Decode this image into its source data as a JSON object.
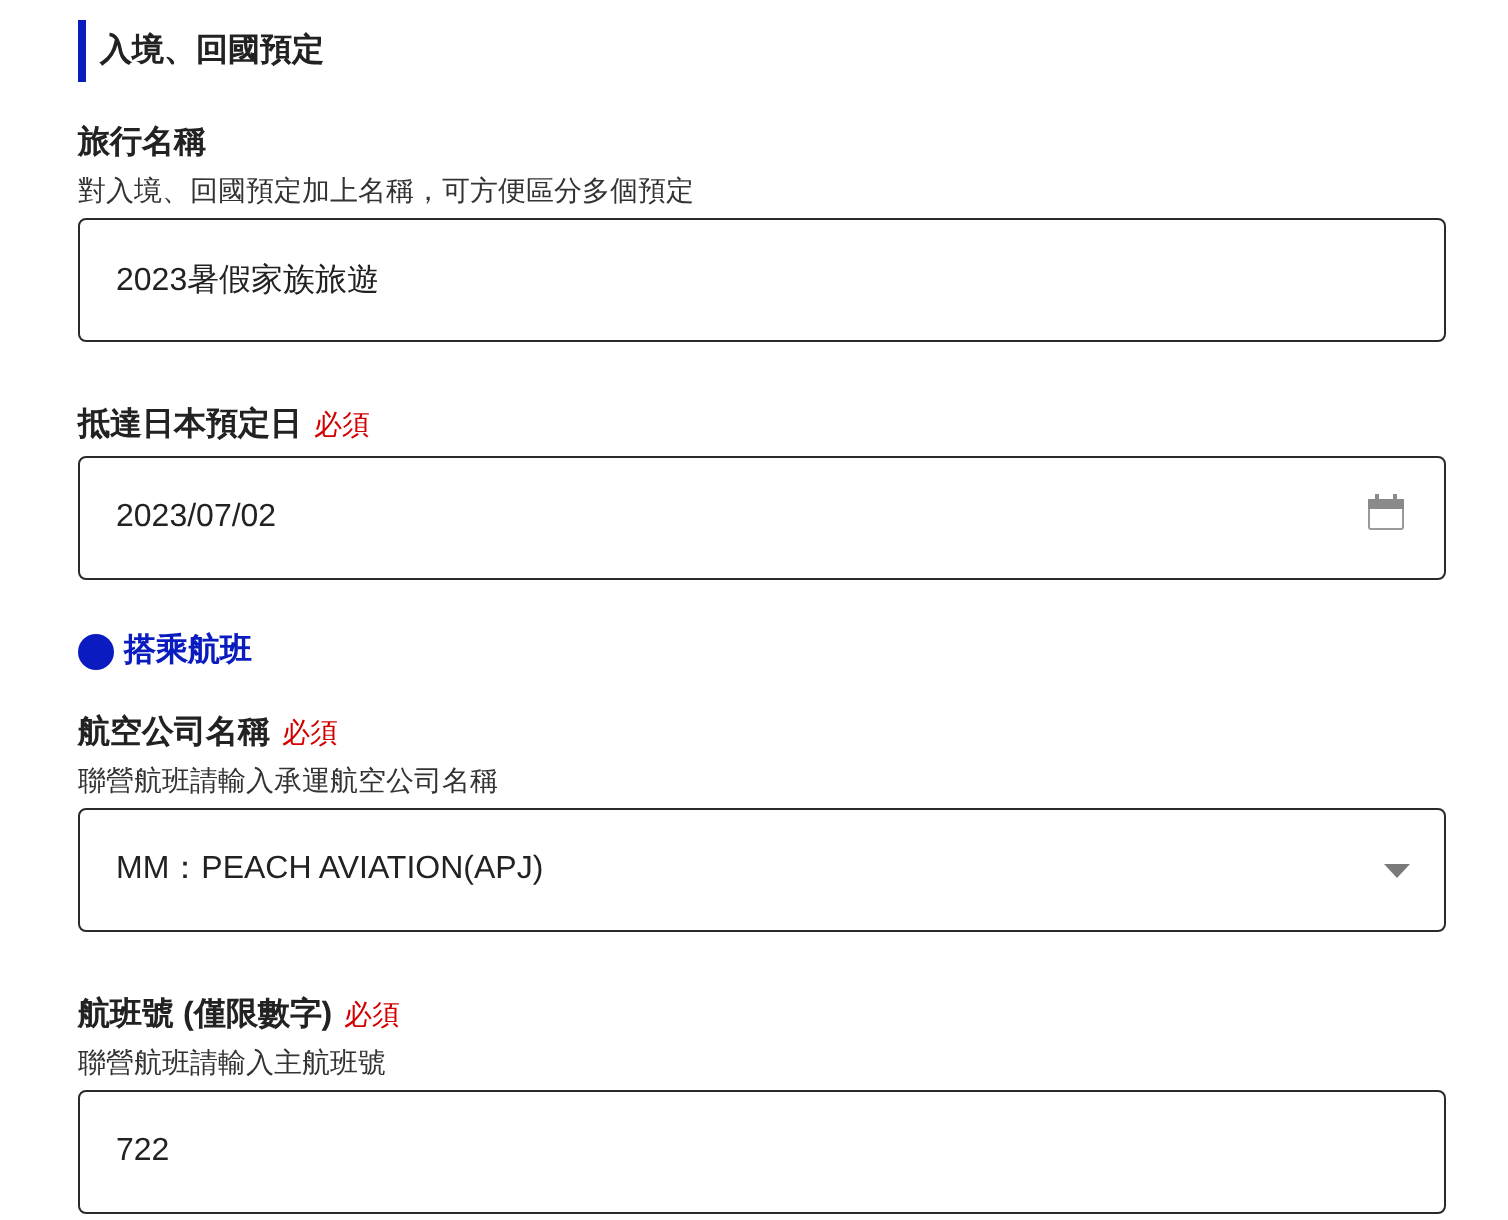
{
  "section": {
    "title": "入境、回國預定"
  },
  "fields": [
    {
      "kind": "text",
      "label": "旅行名稱",
      "hint": "對入境、回國預定加上名稱，可方便區分多個預定",
      "value": "2023暑假家族旅遊"
    },
    {
      "kind": "date",
      "label": "抵達日本預定日",
      "required_tag": "必須",
      "value": "2023/07/02"
    }
  ],
  "subsection": {
    "title": "搭乘航班"
  },
  "flight_fields": [
    {
      "kind": "select",
      "label": "航空公司名稱",
      "required_tag": "必須",
      "hint": "聯營航班請輸入承運航空公司名稱",
      "value": "MM：PEACH AVIATION(APJ)"
    },
    {
      "kind": "text",
      "label": "航班號 (僅限數字)",
      "required_tag": "必須",
      "hint": "聯營航班請輸入主航班號",
      "value": "722"
    }
  ]
}
